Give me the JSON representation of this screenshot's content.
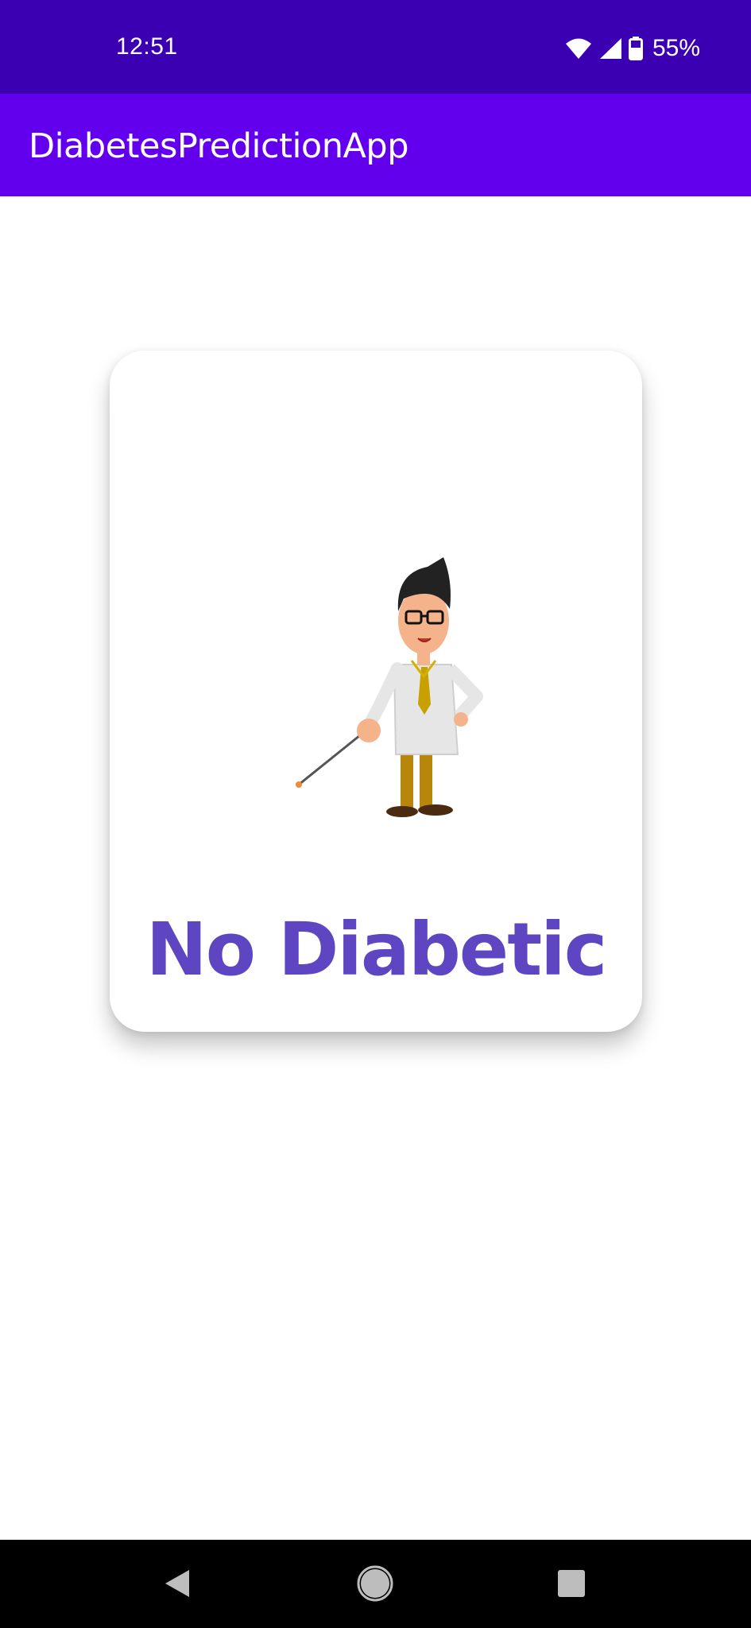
{
  "status_bar": {
    "time": "12:51",
    "battery": "55%",
    "icons": [
      "wifi-icon",
      "signal-icon",
      "battery-icon"
    ]
  },
  "app_bar": {
    "title": "DiabetesPredictionApp"
  },
  "result_card": {
    "illustration": "doctor-with-pointer",
    "result": "No Diabetic"
  },
  "nav_bar": {
    "buttons": [
      "back-icon",
      "home-icon",
      "recents-icon"
    ]
  },
  "colors": {
    "status_bar": "#3C00B3",
    "app_bar": "#6200EE",
    "result_text": "#5E45C2",
    "nav_bar": "#000000",
    "background": "#FFFFFF"
  }
}
